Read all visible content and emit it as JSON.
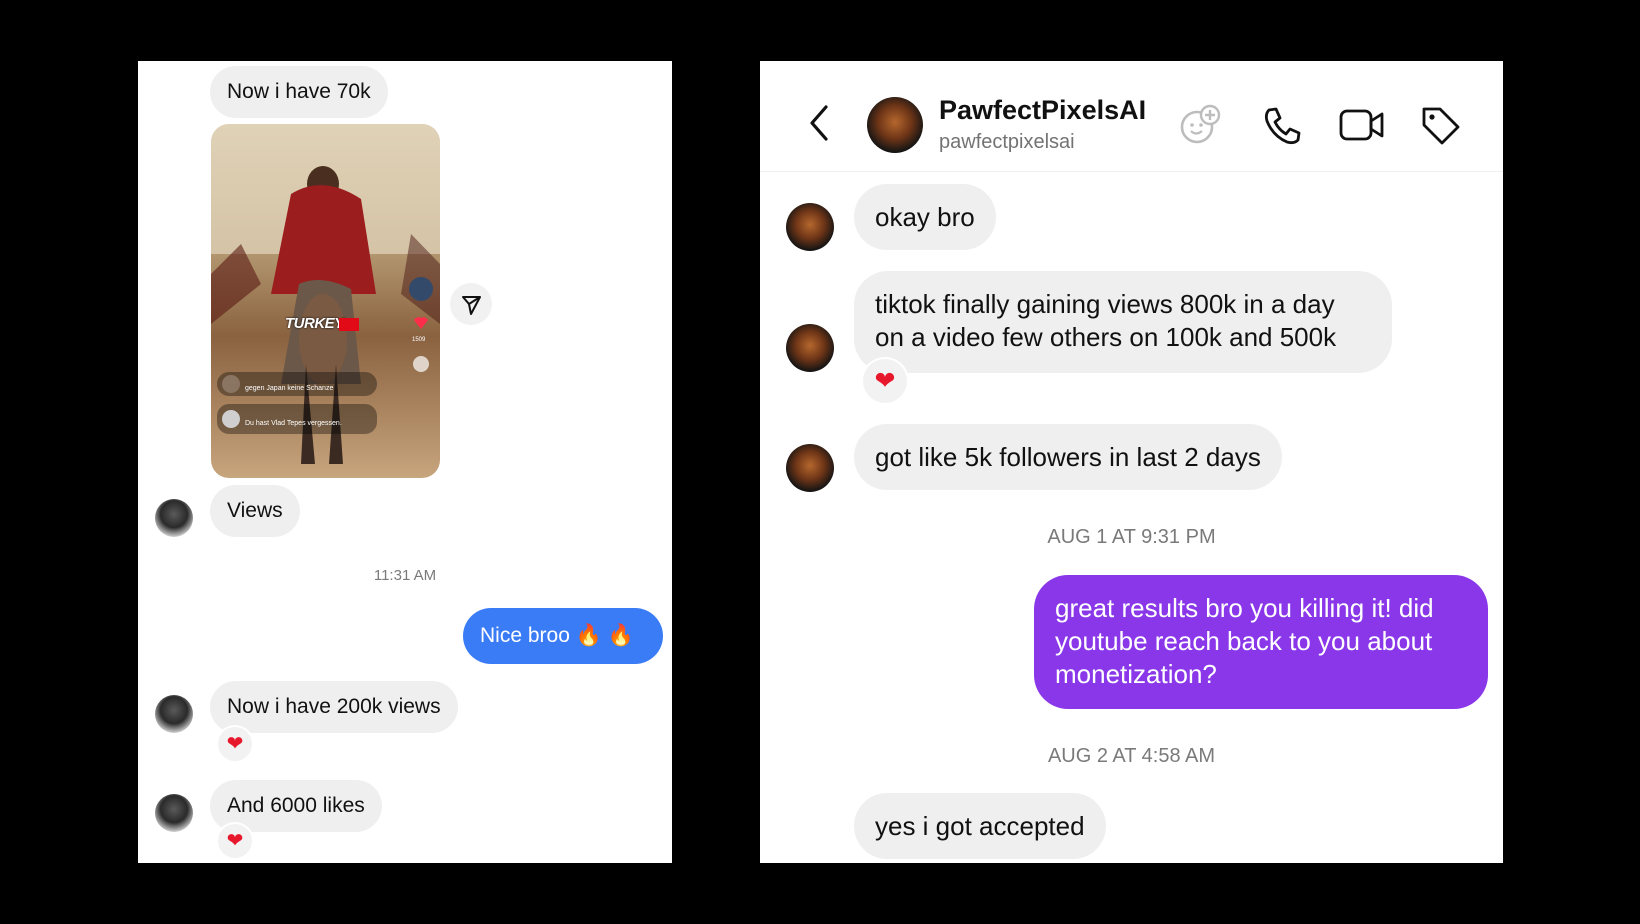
{
  "left": {
    "messages": [
      {
        "text": "Now i have 70k"
      },
      {
        "text": "Views"
      },
      {
        "text": "Nice broo 🔥 🔥"
      },
      {
        "text": "Now i have 200k views",
        "reaction": "❤"
      },
      {
        "text": "And 6000 likes",
        "reaction": "❤"
      }
    ],
    "timestamp": "11:31 AM",
    "shared_video": {
      "caption_overlay": "TURKEY",
      "like_count": "1509",
      "comment_1": "gegen Japan keine Schanze",
      "comment_2": "Du hast Vlad Tepes vergessen."
    },
    "colors": {
      "sent_bubble": "#3a7cf6",
      "received_bubble": "#efefef"
    }
  },
  "right": {
    "header": {
      "display_name": "PawfectPixelsAI",
      "username": "pawfectpixelsai",
      "icons": [
        "back-chevron-icon",
        "add-sticker-icon",
        "phone-icon",
        "video-camera-icon",
        "tag-icon"
      ]
    },
    "messages": [
      {
        "text": "okay bro"
      },
      {
        "text_line1": "tiktok finally gaining views 800k in a day",
        "text_line2": "on a video few others on 100k and 500k",
        "reaction": "❤"
      },
      {
        "text": "got like 5k followers in last 2 days"
      },
      {
        "text_line1": "great results bro you killing it! did",
        "text_line2": "youtube reach back to you about",
        "text_line3": "monetization?"
      },
      {
        "text": "yes i got accepted"
      }
    ],
    "timestamps": [
      "AUG 1 AT 9:31 PM",
      "AUG 2 AT 4:58 AM"
    ],
    "colors": {
      "sent_bubble": "#8a37ea",
      "received_bubble": "#efefef"
    }
  }
}
